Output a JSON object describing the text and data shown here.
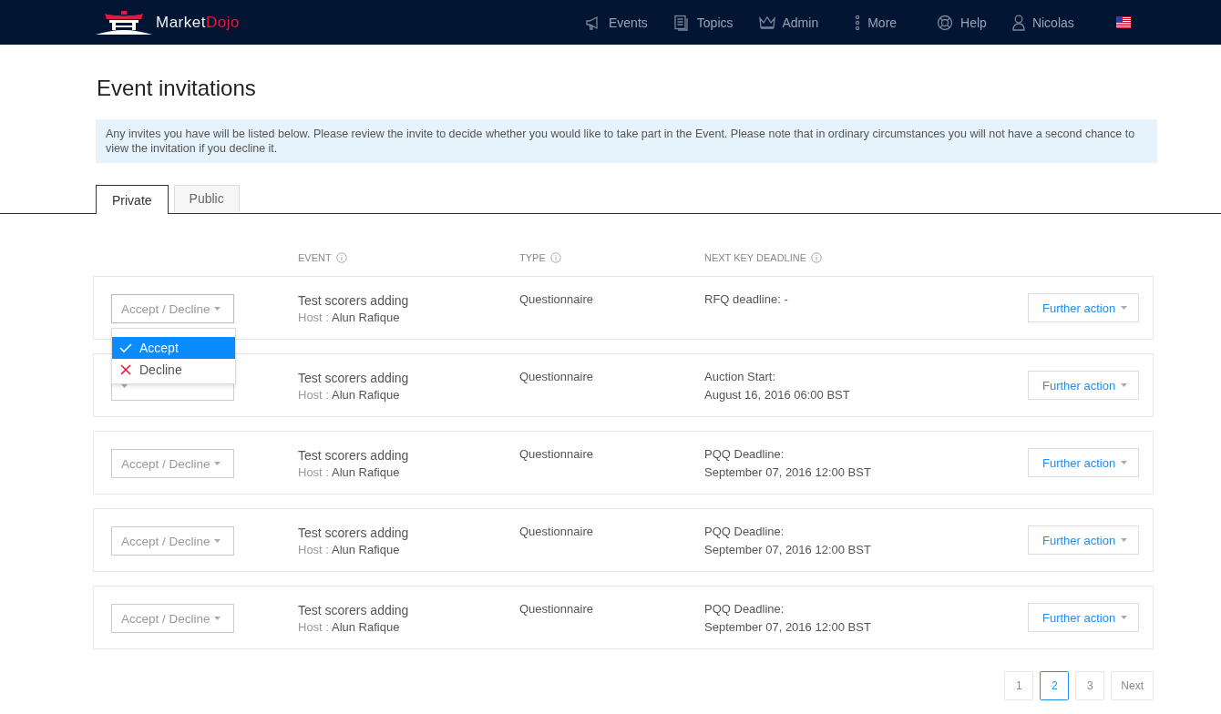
{
  "brand": {
    "name_part_1": "Market",
    "name_part_2": "Dojo"
  },
  "nav": [
    {
      "label": "Events",
      "kind": "megaphone"
    },
    {
      "label": "Topics",
      "kind": "document"
    },
    {
      "label": "Admin",
      "kind": "crown"
    },
    {
      "label": "More",
      "kind": "dots"
    },
    {
      "label": "Help",
      "kind": "lifebuoy"
    },
    {
      "label": "Nicolas",
      "kind": "user"
    },
    {
      "kind": "flag"
    }
  ],
  "page_title": "Event invitations",
  "notice": "Any invites you have will be listed below. Please review the invite to decide whether you would like to take part in the Event. Please note that in ordinary circumstances you will not have a second chance to view the invitation if you decline it.",
  "tabs": [
    {
      "label": "Private",
      "selected": true
    },
    {
      "label": "Public",
      "selected": false
    }
  ],
  "table": {
    "columns": [
      {
        "label": "EVENT"
      },
      {
        "label": "TYPE"
      },
      {
        "label": "NEXT KEY DEADLINE"
      }
    ],
    "rows": [
      {
        "select": "Accept / Decline",
        "event": "Test scorers adding",
        "host_label": "Host :",
        "host": "Alun Rafique",
        "type": "Questionnaire",
        "deadline": [
          "RFQ deadline: -"
        ],
        "action": "Further action",
        "menu_open": true
      },
      {
        "event": "Test scorers adding",
        "host_label": "Host :",
        "host": "Alun Rafique",
        "type": "Questionnaire",
        "deadline": [
          "Auction Start:",
          "August 16, 2016 06:00 BST"
        ],
        "action": "Further action",
        "menu_open": false
      },
      {
        "select": "Accept / Decline",
        "event": "Test scorers adding",
        "host_label": "Host :",
        "host": "Alun Rafique",
        "type": "Questionnaire",
        "deadline": [
          "PQQ Deadline:",
          "September 07, 2016 12:00 BST"
        ],
        "action": "Further action",
        "menu_open": false
      },
      {
        "select": "Accept / Decline",
        "event": "Test scorers adding",
        "host_label": "Host :",
        "host": "Alun Rafique",
        "type": "Questionnaire",
        "deadline": [
          "PQQ Deadline:",
          "September 07, 2016 12:00 BST"
        ],
        "action": "Further action",
        "menu_open": false
      },
      {
        "select": "Accept / Decline",
        "event": "Test scorers adding",
        "host_label": "Host :",
        "host": "Alun Rafique",
        "type": "Questionnaire",
        "deadline": [
          "PQQ Deadline:",
          "September 07, 2016 12:00 BST"
        ],
        "action": "Further action",
        "menu_open": false
      }
    ]
  },
  "menu": [
    {
      "label": "Accept",
      "kind": "accept",
      "selected": true
    },
    {
      "label": "Decline",
      "kind": "decline",
      "selected": false
    }
  ],
  "pagination": [
    {
      "label": "1",
      "selected": false
    },
    {
      "label": "2",
      "selected": true
    },
    {
      "label": "3",
      "selected": false
    },
    {
      "label": "Next",
      "selected": false
    }
  ]
}
